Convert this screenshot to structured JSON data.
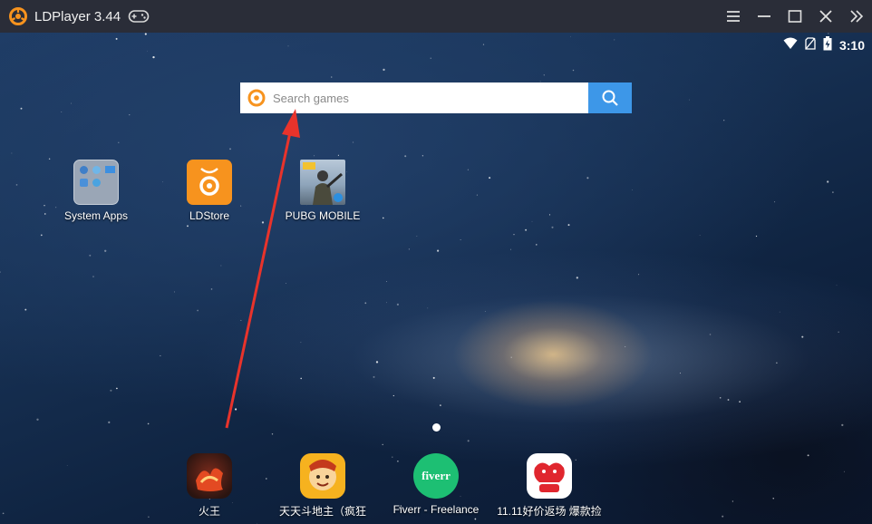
{
  "window": {
    "title": "LDPlayer 3.44",
    "accent_color": "#f7931e",
    "controls": [
      "menu-icon",
      "minimize-icon",
      "maximize-icon",
      "close-icon",
      "double-chevron-right-icon"
    ]
  },
  "status_bar": {
    "time": "3:10",
    "icons": [
      "wifi-icon",
      "no-sim-icon",
      "battery-charging-icon"
    ]
  },
  "search": {
    "placeholder": "Search games",
    "value": "",
    "button_color": "#3d97e8"
  },
  "desktop_apps": [
    {
      "label": "System Apps",
      "icon": "folder-icon"
    },
    {
      "label": "LDStore",
      "icon": "ldstore-icon"
    },
    {
      "label": "PUBG MOBILE",
      "icon": "pubg-icon"
    }
  ],
  "dock_apps": [
    {
      "label": "火王",
      "icon": "huowang-icon"
    },
    {
      "label": "天天斗地主（疯狂",
      "icon": "doudizhu-icon"
    },
    {
      "label": "Fiverr - Freelance",
      "icon": "fiverr-icon"
    },
    {
      "label": "11.11好价返场 爆款捡",
      "icon": "shopping-icon"
    }
  ],
  "fiverr_icon_text": "fiverr",
  "annotation": {
    "type": "arrow",
    "color": "#e8332b"
  },
  "pager": {
    "pages": 1,
    "current": 1
  }
}
